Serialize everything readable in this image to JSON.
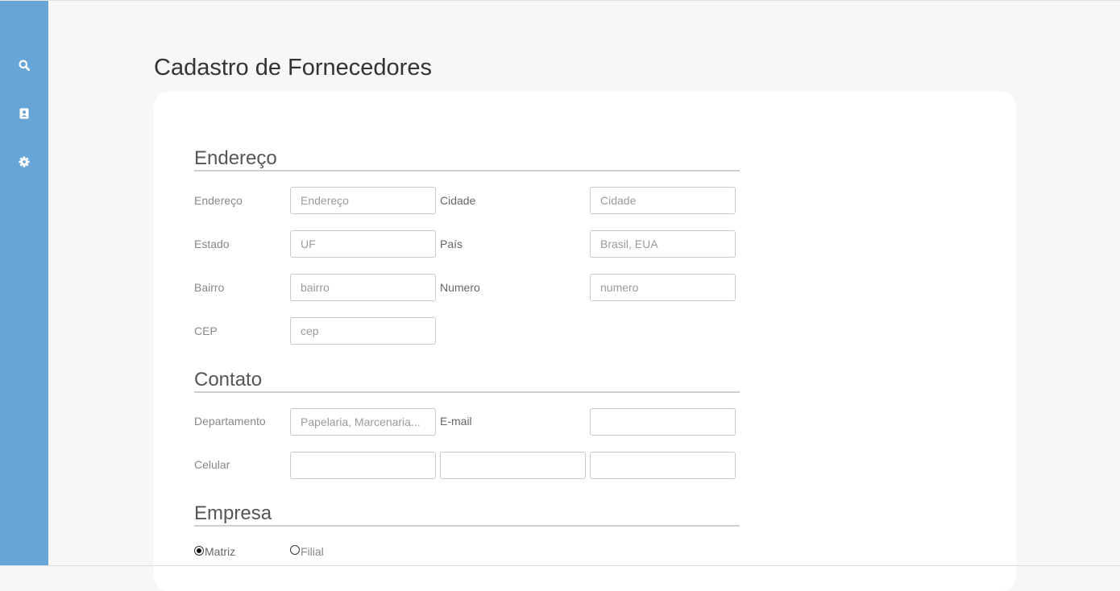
{
  "sidebar": {
    "items": [
      {
        "icon": "search-icon"
      },
      {
        "icon": "contact-card-icon"
      },
      {
        "icon": "gear-icon"
      }
    ],
    "background": "#68a5d7"
  },
  "page": {
    "title": "Cadastro de Fornecedores"
  },
  "endereco": {
    "title": "Endereço",
    "endereco_label": "Endereço",
    "endereco_placeholder": "Endereço",
    "cidade_label": "Cidade",
    "cidade_placeholder": "Cidade",
    "estado_label": "Estado",
    "estado_placeholder": "UF",
    "pais_label": "País",
    "pais_placeholder": "Brasil, EUA",
    "bairro_label": "Bairro",
    "bairro_placeholder": "bairro",
    "numero_label": "Numero",
    "numero_placeholder": "numero",
    "cep_label": "CEP",
    "cep_placeholder": "cep"
  },
  "contato": {
    "title": "Contato",
    "departamento_label": "Departamento",
    "departamento_placeholder": "Papelaria, Marcenaria...",
    "email_label": "E-mail",
    "email_value": "",
    "celular_label": "Celular",
    "celular_values": [
      "",
      "",
      ""
    ]
  },
  "empresa": {
    "title": "Empresa",
    "options": [
      {
        "label": "Matriz",
        "checked": true
      },
      {
        "label": "Filial",
        "checked": false
      }
    ]
  }
}
